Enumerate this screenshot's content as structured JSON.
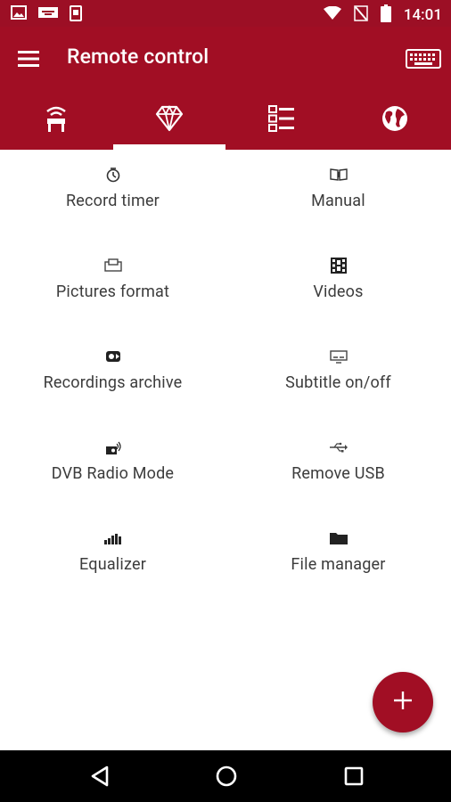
{
  "status_bar": {
    "time": "14:01",
    "icons": [
      "image-icon",
      "cast-icon",
      "phone-icon",
      "wifi-icon",
      "no-signal-icon",
      "battery-icon"
    ]
  },
  "app_bar": {
    "title": "Remote control",
    "menu_icon": "hamburger-menu-icon",
    "keyboard_icon": "keyboard-icon",
    "color": "#a10e24"
  },
  "tabs": [
    {
      "icon": "remote-signal-icon",
      "active": false
    },
    {
      "icon": "diamond-icon",
      "active": true
    },
    {
      "icon": "list-icon",
      "active": false
    },
    {
      "icon": "globe-icon",
      "active": false
    }
  ],
  "grid": [
    {
      "label": "Record timer",
      "icon": "timer-icon"
    },
    {
      "label": "Manual",
      "icon": "manual-book-icon"
    },
    {
      "label": "Pictures format",
      "icon": "picture-format-icon"
    },
    {
      "label": "Videos",
      "icon": "film-icon"
    },
    {
      "label": "Recordings archive",
      "icon": "recordings-icon"
    },
    {
      "label": "Subtitle on/off",
      "icon": "subtitle-icon"
    },
    {
      "label": "DVB Radio Mode",
      "icon": "radio-icon"
    },
    {
      "label": "Remove USB",
      "icon": "usb-icon"
    },
    {
      "label": "Equalizer",
      "icon": "equalizer-icon"
    },
    {
      "label": "File manager",
      "icon": "folder-icon"
    }
  ],
  "fab": {
    "icon": "plus-icon"
  },
  "nav_bar": [
    "back-icon",
    "home-icon",
    "recents-icon"
  ]
}
